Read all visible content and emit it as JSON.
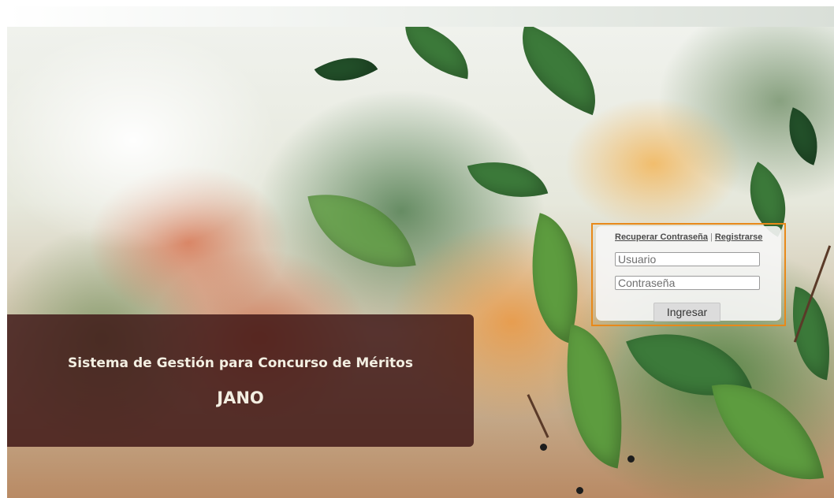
{
  "banner": {
    "subtitle": "Sistema de Gestión para Concurso de Méritos",
    "app_name": "JANO"
  },
  "login": {
    "recover_link": "Recuperar Contraseña",
    "separator": "|",
    "register_link": "Registrarse",
    "username_placeholder": "Usuario",
    "password_placeholder": "Contraseña",
    "submit_label": "Ingresar"
  },
  "colors": {
    "login_highlight_border": "#e8891a",
    "banner_background": "#3c1414",
    "banner_text": "#f3efe2"
  }
}
